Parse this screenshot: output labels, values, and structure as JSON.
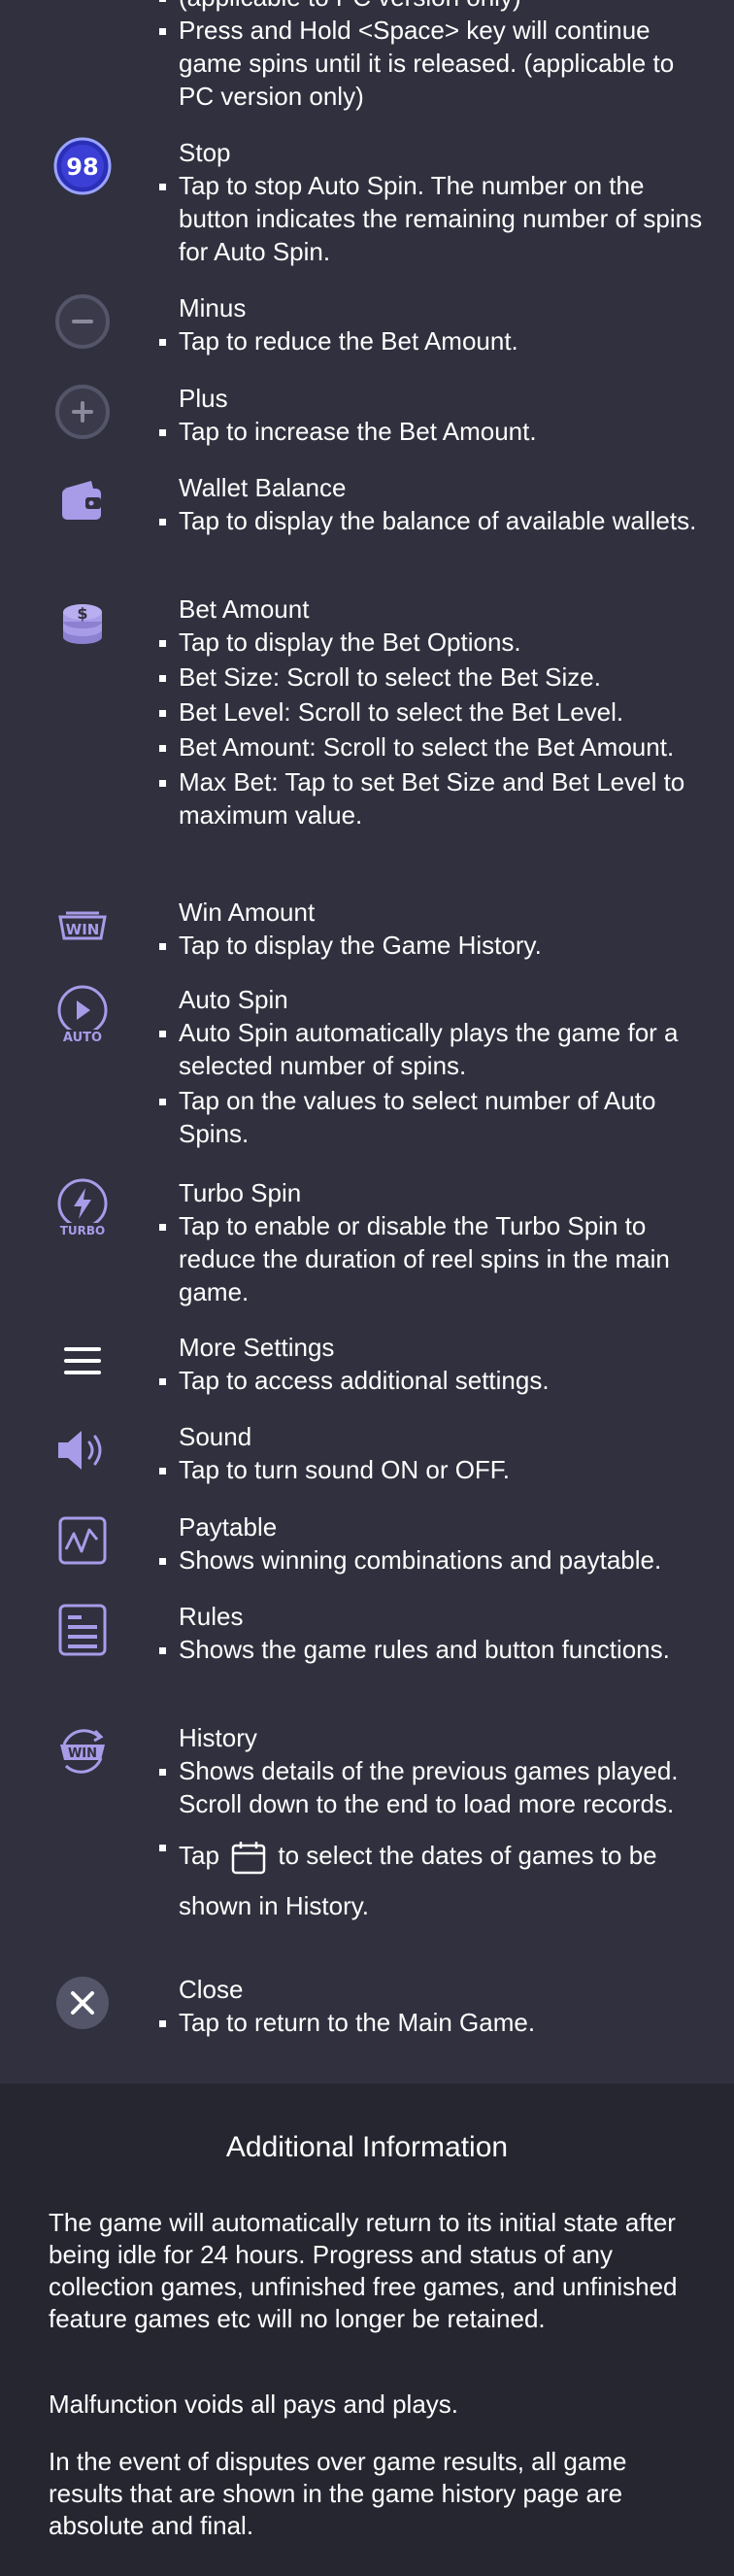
{
  "top_partial": {
    "cut_text": "(applicable to PC version only)",
    "bullet": "Press and Hold <Space> key will continue game spins until it is released. (applicable to PC version only)"
  },
  "items": {
    "stop": {
      "icon_label": "98",
      "title": "Stop",
      "bullets": [
        "Tap to stop Auto Spin. The number on the button indicates the remaining number of spins for Auto Spin."
      ]
    },
    "minus": {
      "title": "Minus",
      "bullets": [
        "Tap to reduce the Bet Amount."
      ]
    },
    "plus": {
      "title": "Plus",
      "bullets": [
        "Tap to increase the Bet Amount."
      ]
    },
    "wallet": {
      "title": "Wallet Balance",
      "bullets": [
        "Tap to display the balance of available wallets."
      ]
    },
    "bet": {
      "title": "Bet Amount",
      "bullets": [
        "Tap to display the Bet Options.",
        "Bet Size: Scroll to select the Bet Size.",
        "Bet Level: Scroll to select the Bet Level.",
        "Bet Amount: Scroll to select the Bet Amount.",
        "Max Bet: Tap to set Bet Size and Bet Level to maximum value."
      ]
    },
    "win": {
      "icon_label": "WIN",
      "title": "Win Amount",
      "bullets": [
        "Tap to display the Game History."
      ]
    },
    "auto": {
      "icon_label": "AUTO",
      "title": "Auto Spin",
      "bullets": [
        "Auto Spin automatically plays the game for a selected number of spins.",
        "Tap on the values to select number of Auto Spins."
      ]
    },
    "turbo": {
      "icon_label": "TURBO",
      "title": "Turbo Spin",
      "bullets": [
        "Tap to enable or disable the Turbo Spin to reduce the duration of reel spins in the main game."
      ]
    },
    "more": {
      "title": "More Settings",
      "bullets": [
        "Tap to access additional settings."
      ]
    },
    "sound": {
      "title": "Sound",
      "bullets": [
        "Tap to turn sound ON or OFF."
      ]
    },
    "paytable": {
      "title": "Paytable",
      "bullets": [
        "Shows winning combinations and paytable."
      ]
    },
    "rules": {
      "title": "Rules",
      "bullets": [
        "Shows the game rules and button functions."
      ]
    },
    "history": {
      "icon_label": "WIN",
      "title": "History",
      "bullets": [
        "Shows details of the previous games played. Scroll down to the end to load more records."
      ],
      "tap_prefix": "Tap",
      "tap_suffix": "to select the dates of games to be shown in History."
    },
    "close": {
      "title": "Close",
      "bullets": [
        "Tap to return to the Main Game."
      ]
    }
  },
  "additional": {
    "title": "Additional Information",
    "paragraphs": [
      "The game will automatically return to its initial state after being idle for 24 hours. Progress and status of any collection games, unfinished free games, and unfinished feature games etc will no longer be retained.",
      "Malfunction voids all pays and plays.",
      "In the event of disputes over game results, all game results that are shown in the game history page are absolute and final."
    ]
  },
  "colors": {
    "background": "#30303e",
    "lower_background": "#262631",
    "icon_purple": "#a89be8",
    "icon_gray": "#5a5a6a",
    "stop_blue": "#3b3fd6"
  }
}
